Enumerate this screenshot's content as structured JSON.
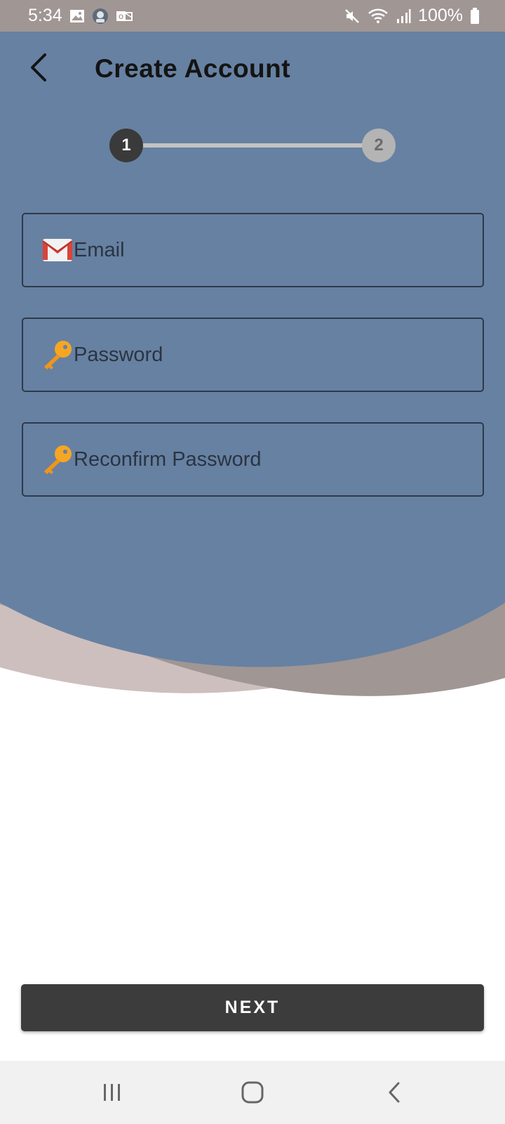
{
  "status_bar": {
    "time": "5:34",
    "battery": "100%",
    "icons": [
      "gallery-icon",
      "app-avatar-icon",
      "outlook-icon",
      "mute-icon",
      "wifi-icon",
      "signal-icon",
      "battery-icon"
    ]
  },
  "header": {
    "title": "Create Account",
    "back_icon": "chevron-left-icon"
  },
  "stepper": {
    "steps": [
      "1",
      "2"
    ],
    "current_step": 1
  },
  "form": {
    "email": {
      "placeholder": "Email",
      "value": "",
      "icon": "gmail-icon"
    },
    "password": {
      "placeholder": "Password",
      "value": "",
      "icon": "key-icon"
    },
    "reconfirm_password": {
      "placeholder": "Reconfirm Password",
      "value": "",
      "icon": "key-icon"
    }
  },
  "next_button": {
    "label": "NEXT"
  },
  "nav_bar": {
    "items": [
      "recents-icon",
      "home-icon",
      "back-icon"
    ]
  },
  "colors": {
    "header_background": "#6781a2",
    "status_bar": "#a09694",
    "wave_light": "#cdbfbd",
    "wave_dark": "#a09694",
    "button": "#3c3c3c",
    "step_active": "#3a3a3a",
    "step_inactive": "#b4b4b4"
  }
}
